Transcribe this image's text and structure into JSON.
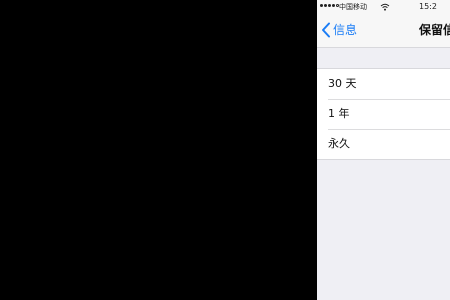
{
  "status_bar": {
    "carrier": "中国移动",
    "time": "15:2"
  },
  "nav": {
    "back_label": "信息",
    "title": "保留信"
  },
  "options": [
    {
      "label": "30 天"
    },
    {
      "label": "1 年"
    },
    {
      "label": "永久"
    }
  ],
  "colors": {
    "accent": "#1a7cf5",
    "background": "#efeff4",
    "bars": "#f7f7f7",
    "letterbox": "#000000"
  }
}
